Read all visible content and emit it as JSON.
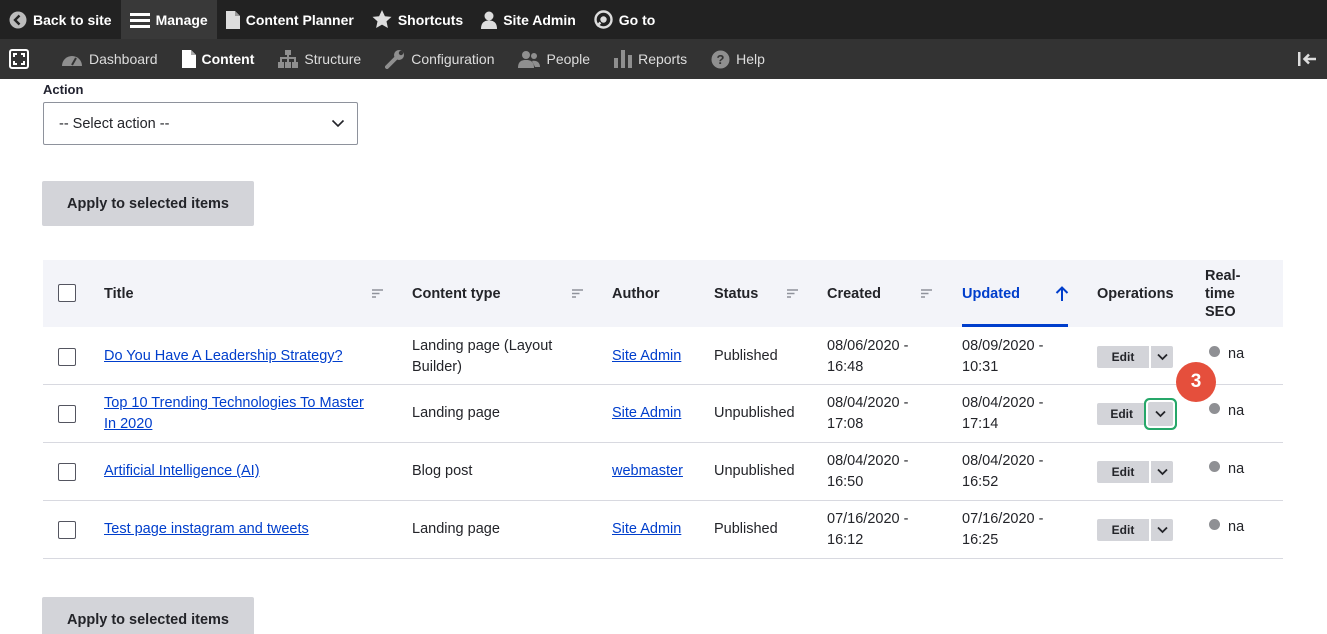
{
  "toolbar": {
    "back": "Back to site",
    "manage": "Manage",
    "content_planner": "Content Planner",
    "shortcuts": "Shortcuts",
    "site_admin": "Site Admin",
    "go_to": "Go to"
  },
  "tray": {
    "items": [
      "Dashboard",
      "Content",
      "Structure",
      "Configuration",
      "People",
      "Reports",
      "Help"
    ]
  },
  "form": {
    "action_label": "Action",
    "select_value": "-- Select action --",
    "apply_label": "Apply to selected items"
  },
  "table": {
    "headers": {
      "title": "Title",
      "content_type": "Content type",
      "author": "Author",
      "status": "Status",
      "created": "Created",
      "updated": "Updated",
      "operations": "Operations",
      "seo_1": "Real-",
      "seo_2": "time",
      "seo_3": "SEO"
    },
    "rows": [
      {
        "title_1": "Do You Have A Leadership Strategy?",
        "title_2": "",
        "type_1": "Landing page (Layout",
        "type_2": "Builder)",
        "author": "Site Admin",
        "status": "Published",
        "created_1": "08/06/2020 -",
        "created_2": "16:48",
        "updated_1": "08/09/2020 -",
        "updated_2": "10:31",
        "edit": "Edit",
        "seo": "na"
      },
      {
        "title_1": "Top 10 Trending Technologies To Master",
        "title_2": "In 2020",
        "type_1": "Landing page",
        "type_2": "",
        "author": "Site Admin",
        "status": "Unpublished",
        "created_1": "08/04/2020 -",
        "created_2": "17:08",
        "updated_1": "08/04/2020 -",
        "updated_2": "17:14",
        "edit": "Edit",
        "seo": "na"
      },
      {
        "title_1": "Artificial Intelligence (AI)",
        "title_2": "",
        "type_1": "Blog post",
        "type_2": "",
        "author": "webmaster",
        "status": "Unpublished",
        "created_1": "08/04/2020 -",
        "created_2": "16:50",
        "updated_1": "08/04/2020 -",
        "updated_2": "16:52",
        "edit": "Edit",
        "seo": "na"
      },
      {
        "title_1": "Test page instagram and tweets",
        "title_2": "",
        "type_1": "Landing page",
        "type_2": "",
        "author": "Site Admin",
        "status": "Published",
        "created_1": "07/16/2020 -",
        "created_2": "16:12",
        "updated_1": "07/16/2020 -",
        "updated_2": "16:25",
        "edit": "Edit",
        "seo": "na"
      }
    ]
  },
  "badge": "3",
  "colors": {
    "link": "#003ecc",
    "focus": "#26a769",
    "badge": "#e54f3c",
    "toolbar": "#222222",
    "tray": "#333333"
  }
}
